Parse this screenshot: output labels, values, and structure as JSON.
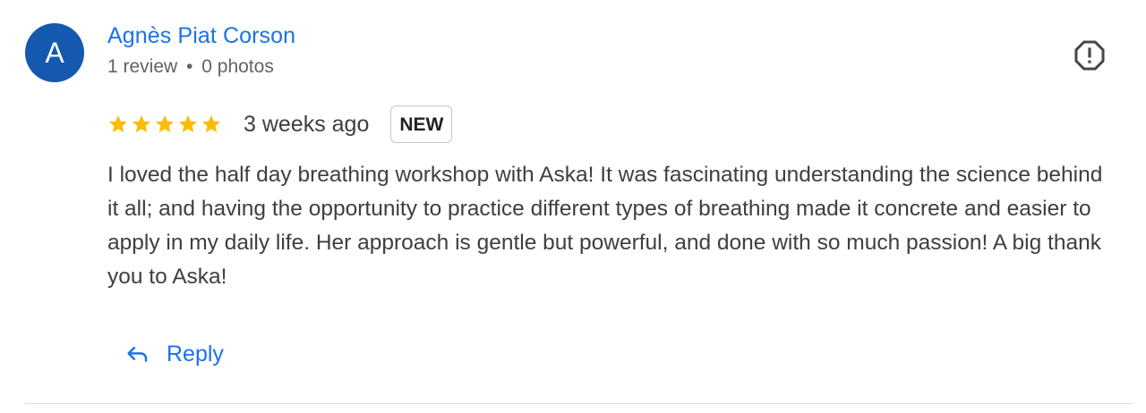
{
  "review": {
    "author": {
      "avatar_letter": "A",
      "avatar_color": "#1558b0",
      "name": "Agnès Piat Corson",
      "review_count": "1 review",
      "separator": "•",
      "photo_count": "0 photos"
    },
    "report_icon": "report-flag-icon",
    "rating": {
      "stars": 5,
      "star_color": "#fbbc04"
    },
    "time_ago": "3 weeks ago",
    "badge": "NEW",
    "text": "I loved the half day breathing workshop with Aska! It was fascinating understanding the science behind it all; and having the opportunity to practice different types of breathing made it concrete and easier to apply in my daily life. Her approach is gentle but powerful, and done with so much passion! A big thank you to Aska!",
    "actions": {
      "reply_label": "Reply",
      "reply_icon": "reply-arrow-icon"
    },
    "accent_color": "#1a73e8"
  }
}
